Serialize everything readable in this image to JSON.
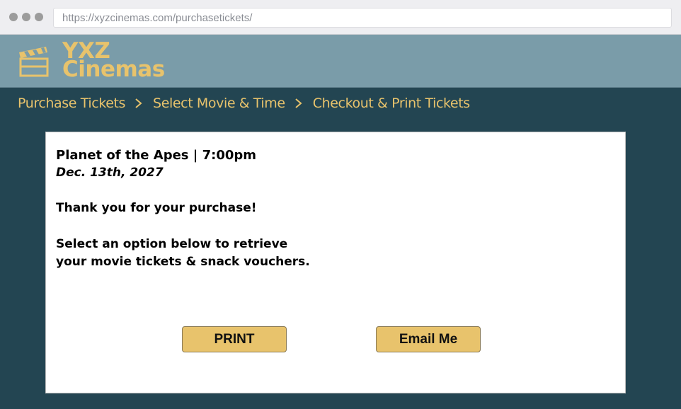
{
  "browser": {
    "url": "https://xyzcinemas.com/purchasetickets/"
  },
  "brand": {
    "line1": "YXZ",
    "line2": "Cinemas",
    "color": "#e8c36c"
  },
  "breadcrumb": [
    {
      "label": "Purchase Tickets"
    },
    {
      "label": "Select Movie & Time"
    },
    {
      "label": "Checkout & Print Tickets"
    }
  ],
  "confirmation": {
    "title": "Planet of the Apes | 7:00pm",
    "date": "Dec. 13th, 2027",
    "thanks": "Thank you for your purchase!",
    "instruction_line1": "Select an option below to retrieve",
    "instruction_line2": "your movie tickets & snack vouchers."
  },
  "actions": {
    "print_label": "PRINT",
    "email_label": "Email Me"
  },
  "colors": {
    "header_bg": "#7a9ca9",
    "page_bg": "#234552",
    "accent": "#e8c36c"
  }
}
